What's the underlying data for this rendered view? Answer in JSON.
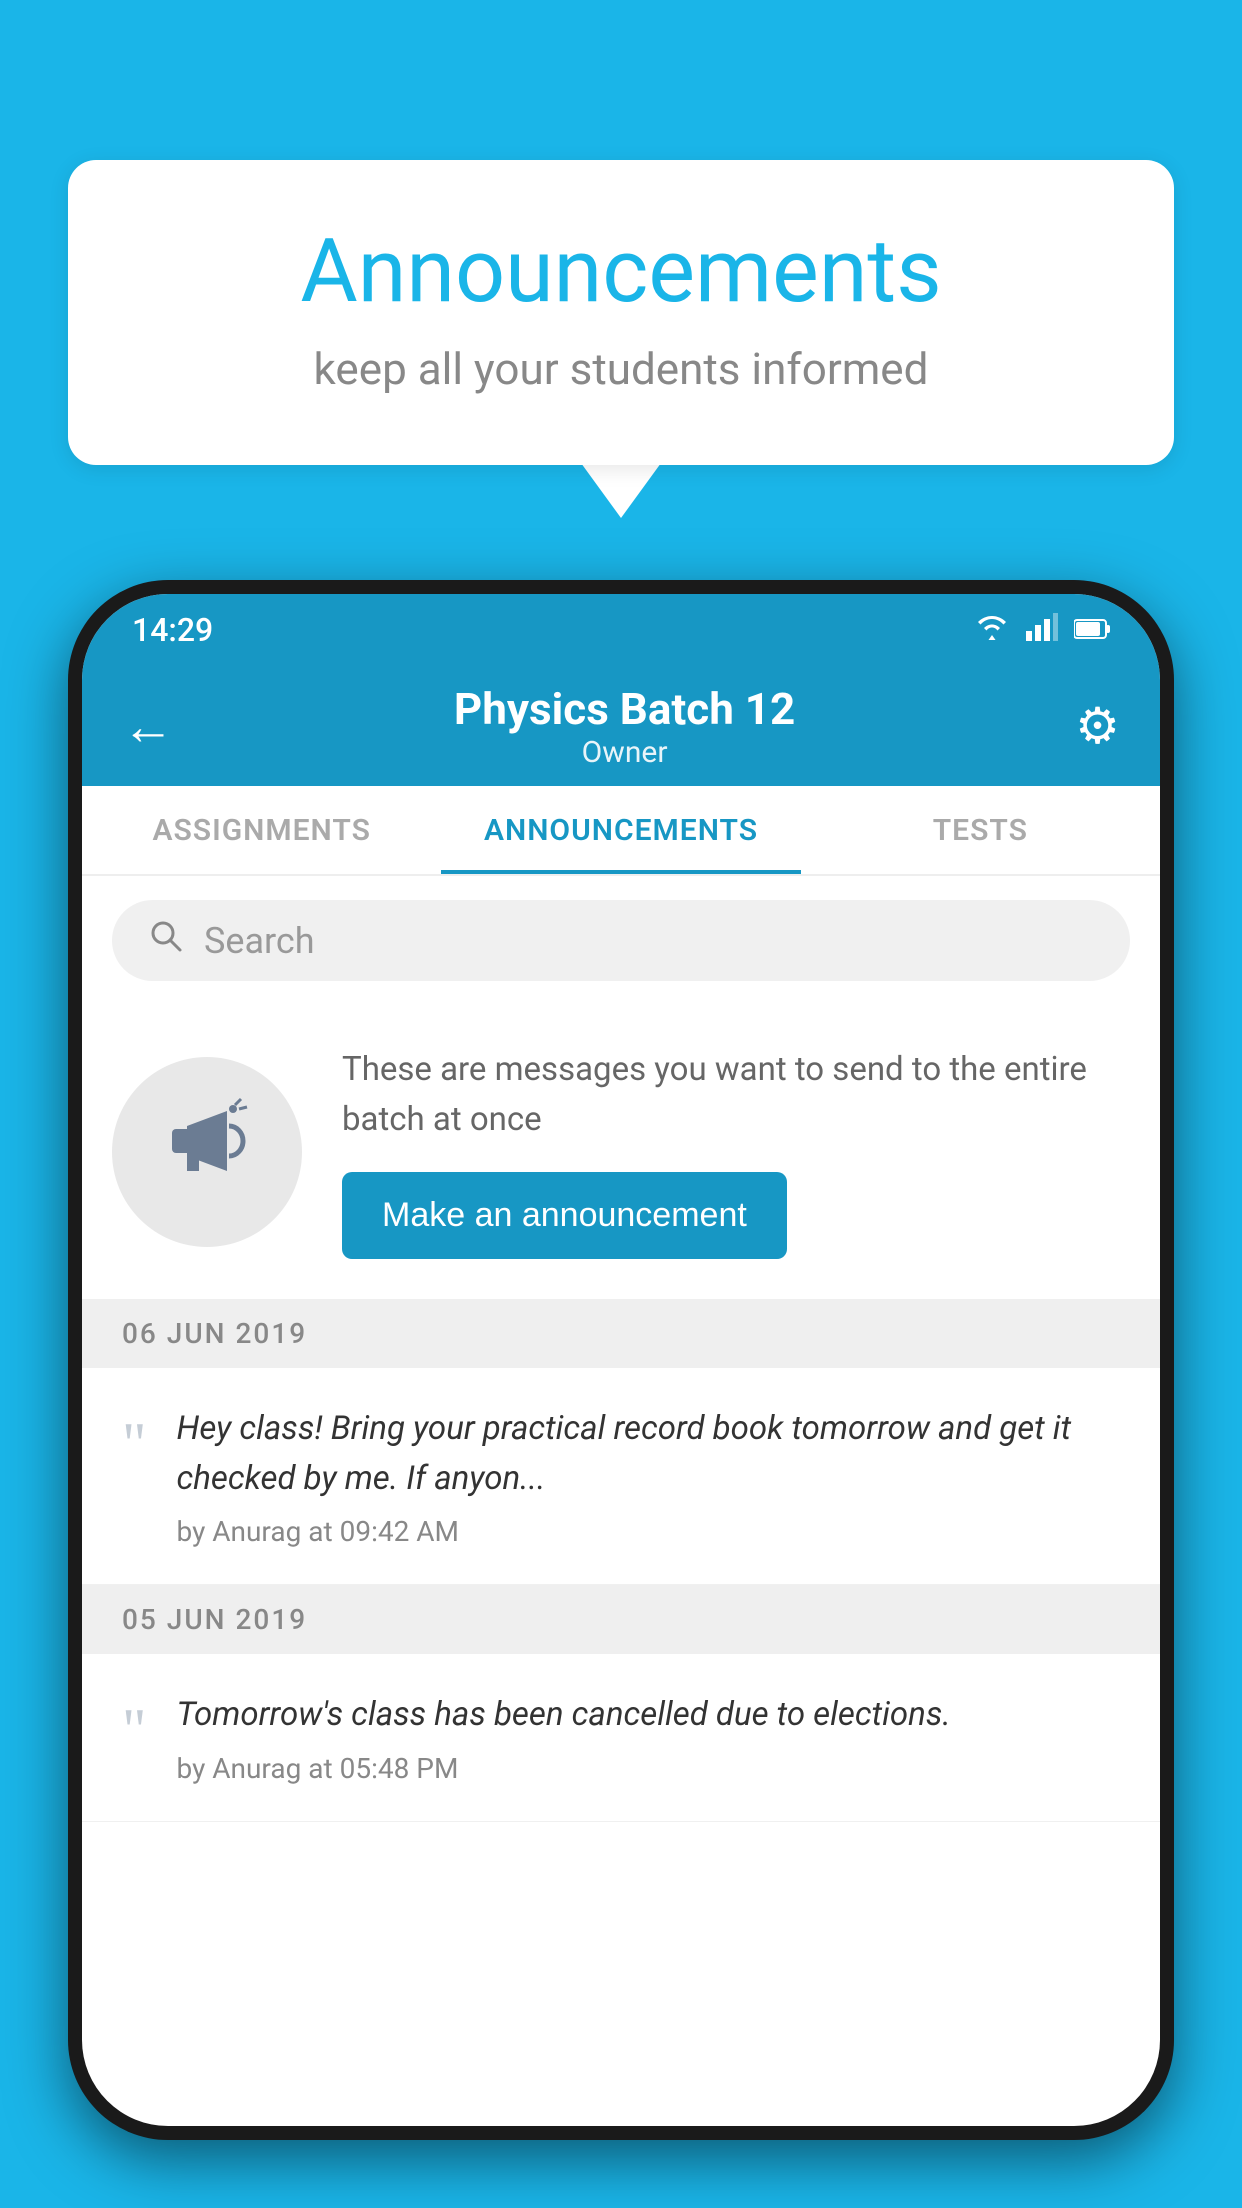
{
  "bubble": {
    "title": "Announcements",
    "subtitle": "keep all your students informed"
  },
  "status_bar": {
    "time": "14:29",
    "icons": [
      "wifi",
      "signal",
      "battery"
    ]
  },
  "app_bar": {
    "back_label": "←",
    "title": "Physics Batch 12",
    "subtitle": "Owner",
    "gear_label": "⚙"
  },
  "tabs": [
    {
      "label": "ASSIGNMENTS",
      "active": false
    },
    {
      "label": "ANNOUNCEMENTS",
      "active": true
    },
    {
      "label": "TESTS",
      "active": false
    }
  ],
  "search": {
    "placeholder": "Search"
  },
  "promo": {
    "text": "These are messages you want to send to the entire batch at once",
    "button_label": "Make an announcement"
  },
  "announcements": [
    {
      "date": "06  JUN  2019",
      "text": "Hey class! Bring your practical record book tomorrow and get it checked by me. If anyon...",
      "meta": "by Anurag at 09:42 AM"
    },
    {
      "date": "05  JUN  2019",
      "text": "Tomorrow's class has been cancelled due to elections.",
      "meta": "by Anurag at 05:48 PM"
    }
  ],
  "colors": {
    "brand": "#1797c4",
    "background": "#1ab5e8",
    "white": "#ffffff"
  }
}
